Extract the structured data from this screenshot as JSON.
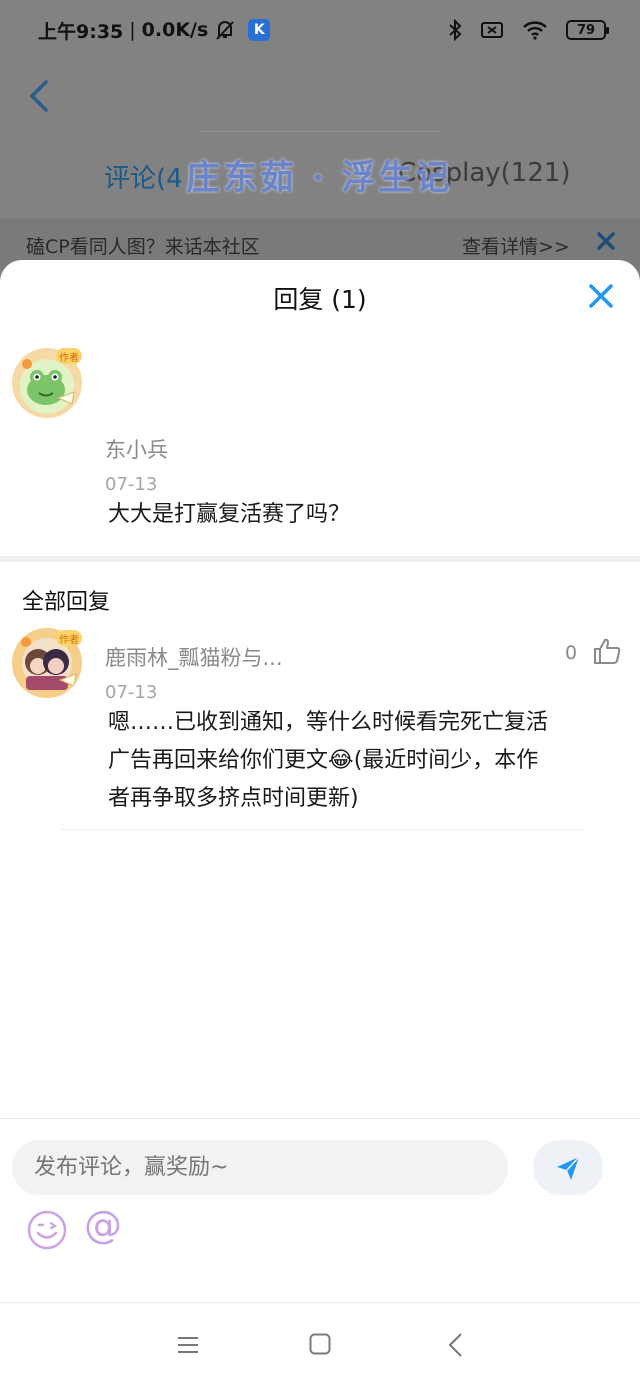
{
  "status_bar": {
    "time": "上午9:35",
    "network_speed": "0.0K/s",
    "app_badge": "K",
    "battery": "79"
  },
  "background": {
    "tab_comments": "评论(4",
    "tab_cosplay": "Cosplay(121)",
    "watermark": "庄东茹 · 浮生记",
    "banner_text": "磕CP看同人图？来话本社区",
    "banner_link": "查看详情>>"
  },
  "sheet": {
    "title": "回复 (1)",
    "main_comment": {
      "author": "东小兵",
      "date": "07-13",
      "text": "大大是打赢复活赛了吗？",
      "badge": "作者"
    },
    "section_title": "全部回复",
    "replies": [
      {
        "author": "鹿雨林_瓢猫粉与...",
        "date": "07-13",
        "likes": "0",
        "badge": "作者",
        "line1": "嗯……已收到通知，等什么时候看完死亡复活",
        "line2": "广告再回来给你们更文😂(最近时间少，本作",
        "line3": "者再争取多挤点时间更新)"
      }
    ]
  },
  "input": {
    "placeholder": "发布评论，赢奖励~",
    "at_label": "@"
  },
  "colors": {
    "accent": "#2196f3",
    "dim_overlay": "#828282"
  }
}
